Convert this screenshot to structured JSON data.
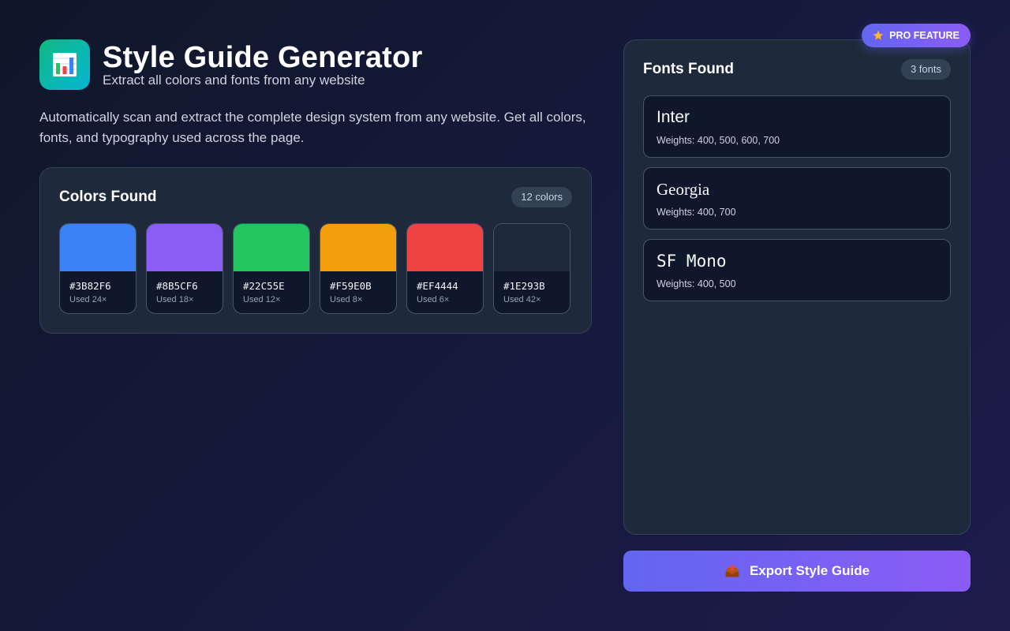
{
  "app": {
    "icon": "bar-chart-icon",
    "title": "Style Guide Generator",
    "subtitle": "Extract all colors and fonts from any website",
    "description": "Automatically scan and extract the complete design system from any website. Get all colors, fonts, and typography used across the page."
  },
  "colors_card": {
    "title": "Colors Found",
    "count_label": "12 colors",
    "swatches": [
      {
        "hex": "#3B82F6",
        "usage": "Used 24×",
        "color": "#3B82F6"
      },
      {
        "hex": "#8B5CF6",
        "usage": "Used 18×",
        "color": "#8B5CF6"
      },
      {
        "hex": "#22C55E",
        "usage": "Used 12×",
        "color": "#22C55E"
      },
      {
        "hex": "#F59E0B",
        "usage": "Used 8×",
        "color": "#F59E0B"
      },
      {
        "hex": "#EF4444",
        "usage": "Used 6×",
        "color": "#EF4444"
      },
      {
        "hex": "#1E293B",
        "usage": "Used 42×",
        "color": "#1E293B"
      }
    ]
  },
  "fonts_card": {
    "title": "Fonts Found",
    "count_label": "3 fonts",
    "fonts": [
      {
        "name": "Inter",
        "weights": "Weights: 400, 500, 600, 700"
      },
      {
        "name": "Georgia",
        "weights": "Weights: 400, 700"
      },
      {
        "name": "SF Mono",
        "weights": "Weights: 400, 500"
      }
    ]
  },
  "pro_badge": {
    "label": "PRO FEATURE",
    "icon": "star-icon"
  },
  "export_button": {
    "label": "Export Style Guide",
    "icon": "outbox-tray-icon"
  },
  "theme": {
    "accent": "#6366f1",
    "accent_end": "#8b5cf6",
    "card_bg": "#1e293b"
  }
}
